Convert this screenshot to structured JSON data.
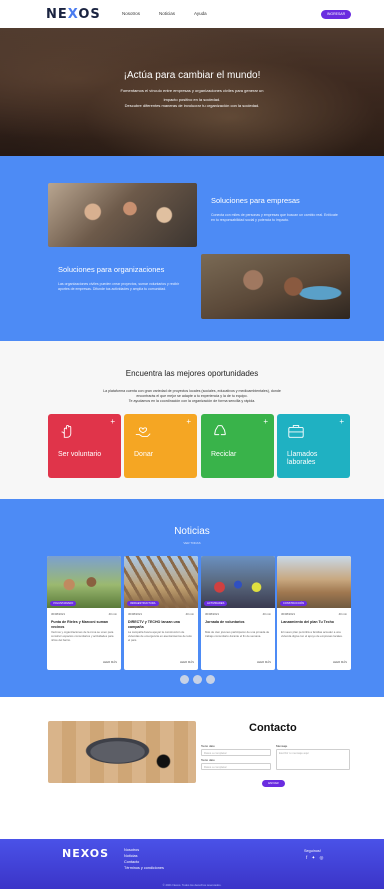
{
  "nav": {
    "logo": "NEXOS",
    "links": [
      "Nosotros",
      "Noticias",
      "Ayuda"
    ],
    "cta": "INGRESAR"
  },
  "hero": {
    "title": "¡Actúa para cambiar el mundo!",
    "line1": "Fomentamos el vínculo entre empresas y organizaciones civiles para generar un",
    "line2": "impacto positivo en la sociedad.",
    "line3": "Descubre diferentes maneras de involucrar tu organización con la sociedad."
  },
  "solutions": {
    "companies_title": "Soluciones para empresas",
    "companies_text": "Conecta con miles de personas y empresas que buscan un cambio real. Enfócate en tu responsabilidad social y potencia tu impacto.",
    "orgs_title": "Soluciones para organizaciones",
    "orgs_text": "Las organizaciones civiles pueden crear proyectos, sumar voluntarios y recibir aportes de empresas. Difunde tus actividades y amplía tu comunidad."
  },
  "opportunities": {
    "title": "Encuentra las mejores oportunidades",
    "line1": "La plataforma cuenta con gran variedad de proyectos locales (sociales, educativos y medioambientales), donde",
    "line2": "encontrarás el que mejor se adapte a tu experiencia y la de tu equipo.",
    "line3": "Te ayudamos en la coordinación con la organización de forma sencilla y rápida.",
    "cards": [
      {
        "label": "Ser voluntario",
        "icon": "hand-icon",
        "color": "#e0344a"
      },
      {
        "label": "Donar",
        "icon": "donate-heart-icon",
        "color": "#f5a623"
      },
      {
        "label": "Reciclar",
        "icon": "recycle-icon",
        "color": "#39b34a"
      },
      {
        "label": "Llamados laborales",
        "icon": "briefcase-icon",
        "color": "#1fb1c2"
      }
    ]
  },
  "news": {
    "title": "Noticias",
    "subtitle": "VER TODAS",
    "items": [
      {
        "tag": "VOLUNTARIADO",
        "date": "30/08/2021",
        "time": "40 min",
        "title": "Punta de Rieles y Marconi suman vecinos",
        "body": "Vecinos y organizaciones de la zona se unen para construir espacios comunitarios y actividades para niños del barrio.",
        "more": "LEER MÁS"
      },
      {
        "tag": "INFRAESTRUCTURA",
        "date": "30/08/2021",
        "time": "40 min",
        "title": "DIRECTV y TECHO lanzan una campaña",
        "body": "La campaña busca apoyar la construcción de viviendas de emergencia en asentamientos de todo el país.",
        "more": "LEER MÁS"
      },
      {
        "tag": "ACTIVIDADES",
        "date": "30/08/2021",
        "time": "40 min",
        "title": "Jornada de voluntarios",
        "body": "Más de cien jóvenes participaron de una jornada de trabajo comunitario durante el fin de semana.",
        "more": "LEER MÁS"
      },
      {
        "tag": "CONSTRUCCIÓN",
        "date": "30/08/2021",
        "time": "40 min",
        "title": "Lanzamiento del plan Tu Techo",
        "body": "El nuevo plan permitirá a familias acceder a una vivienda digna con el apoyo de empresas locales.",
        "more": "LEER MÁS"
      }
    ]
  },
  "contact": {
    "title": "Contacto",
    "name_label": "Texto dato",
    "name_placeholder": "Datos a completar",
    "email_label": "Texto dato",
    "email_placeholder": "Datos a completar",
    "message_label": "Mensaje",
    "message_placeholder": "Escribir tu mensaje aquí",
    "send": "ENVIAR"
  },
  "footer": {
    "logo": "NEXOS",
    "links": [
      "Nosotros",
      "Noticias",
      "Contacto",
      "Términos y condiciones"
    ],
    "social_title": "Seguinos!",
    "social_icons": "f  ✦  ◎",
    "copyright": "© 2021 Nexos. Todos los derechos reservados."
  }
}
